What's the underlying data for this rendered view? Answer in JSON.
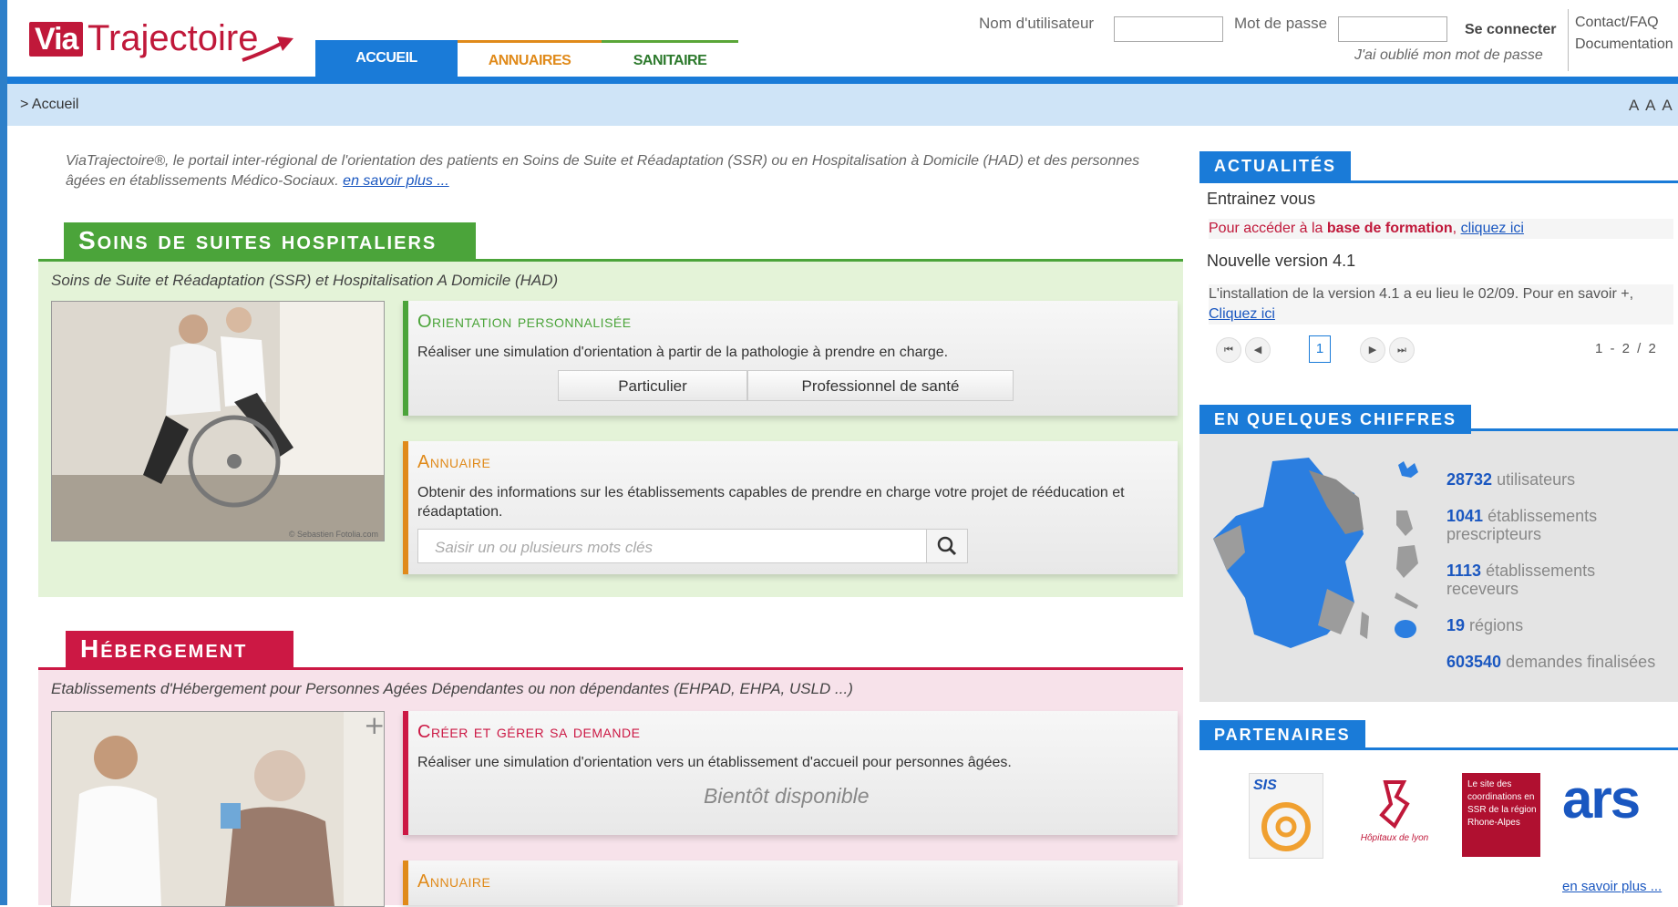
{
  "header": {
    "logo_via": "Via",
    "logo_trajectoire": "Trajectoire",
    "tabs": [
      {
        "label": "ACCUEIL"
      },
      {
        "label": "ANNUAIRES"
      },
      {
        "label": "SANITAIRE"
      }
    ],
    "login": {
      "username_label": "Nom d'utilisateur",
      "username_value": "",
      "password_label": "Mot de passe",
      "password_value": "",
      "connect_label": "Se connecter",
      "forgot_label": "J'ai oublié mon mot de passe"
    },
    "contact_label": "Contact/FAQ",
    "documentation_label": "Documentation"
  },
  "breadcrumb": {
    "text": "> Accueil",
    "text_size_label": "A A A"
  },
  "intro": {
    "text": "ViaTrajectoire®, le portail inter-régional de l'orientation des patients en Soins de Suite et Réadaptation (SSR) ou en Hospitalisation à Domicile (HAD) et des personnes âgées en établissements Médico-Sociaux.",
    "link": "en savoir plus ..."
  },
  "ssr": {
    "title": "Soins de suites hospitaliers",
    "subtitle": "Soins de Suite et Réadaptation (SSR) et Hospitalisation A Domicile (HAD)",
    "orientation": {
      "title": "Orientation personnalisée",
      "text": "Réaliser une simulation d'orientation à partir de la pathologie à prendre en charge.",
      "btn_particulier": "Particulier",
      "btn_professionnel": "Professionnel de santé"
    },
    "annuaire": {
      "title": "Annuaire",
      "text": "Obtenir des informations sur les établissements capables de prendre en charge votre projet de rééducation et réadaptation.",
      "search_placeholder": "Saisir un ou plusieurs mots clés"
    },
    "photo_credit": "© Sebastien Fotolia.com"
  },
  "hebergement": {
    "title": "Hébergement",
    "subtitle": "Etablissements d'Hébergement pour Personnes Agées Dépendantes ou non dépendantes (EHPAD, EHPA, USLD ...)",
    "creer": {
      "title": "Créer et gérer sa demande",
      "text": "Réaliser une simulation d'orientation vers un établissement d'accueil pour personnes âgées.",
      "bientot": "Bientôt disponible"
    },
    "annuaire": {
      "title": "Annuaire"
    }
  },
  "actualites": {
    "title": "ACTUALITÉS",
    "item1_title": "Entrainez vous",
    "item1_text_pre": "Pour accéder à la ",
    "item1_text_bold": "base de formation",
    "item1_link": "cliquez ici",
    "item2_title": "Nouvelle version 4.1",
    "item2_text": "L'installation de la version 4.1 a eu lieu le 02/09. Pour en savoir +,",
    "item2_link": "Cliquez ici",
    "pager_page": "1",
    "pager_count": "1 - 2 / 2"
  },
  "chiffres": {
    "title": "EN QUELQUES CHIFFRES",
    "stats": [
      {
        "value": "28732",
        "label": "utilisateurs"
      },
      {
        "value": "1041",
        "label": "établissements prescripteurs"
      },
      {
        "value": "1113",
        "label": "établissements receveurs"
      },
      {
        "value": "19",
        "label": "régions"
      },
      {
        "value": "603540",
        "label": "demandes finalisées"
      }
    ]
  },
  "partenaires": {
    "title": "PARTENAIRES",
    "sis_label": "SIS",
    "hospices_label": "Hôpitaux de lyon",
    "ssr_label": "Le site des coordinations en SSR de la région Rhone-Alpes",
    "ars_label": "ars",
    "savoir_plus": "en savoir plus ..."
  },
  "colors": {
    "brand_red": "#c0183a",
    "blue": "#1a7bd8",
    "ssr_green": "#4ba43a",
    "heb_red": "#cc1844",
    "annuaire_orange": "#e08a1a"
  }
}
